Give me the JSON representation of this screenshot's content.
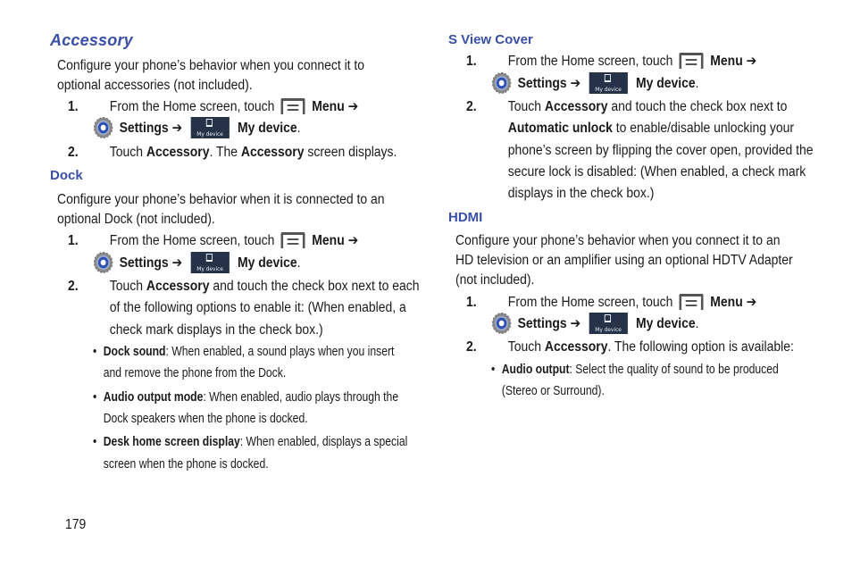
{
  "icons": {
    "menu": "menu-icon",
    "settings": "gear-icon",
    "my_device": "my-device-icon",
    "my_device_caption": "My device",
    "arrow": "➔"
  },
  "common_step1": {
    "num": "1.",
    "pre": "From the Home screen, touch",
    "menu": "Menu",
    "settings": "Settings",
    "my_device": "My device",
    "period": "."
  },
  "accessory": {
    "title": "Accessory",
    "intro_lines": [
      "Configure your phone’s behavior when you connect it to",
      "optional accessories (not included)."
    ],
    "step2": {
      "num": "2.",
      "t1": "Touch ",
      "b1": "Accessory",
      "t2": ". The ",
      "b2": "Accessory",
      "t3": " screen displays."
    }
  },
  "dock": {
    "title": "Dock",
    "intro_lines": [
      "Configure your phone’s behavior when it is connected to an",
      "optional Dock (not included)."
    ],
    "step2": {
      "num": "2.",
      "t1": "Touch ",
      "b1": "Accessory",
      "t2": " and touch the check box next to each",
      "line2": "of the following options to enable it: (When enabled, a",
      "line3": "check mark displays in the check box.)"
    },
    "bullets": [
      {
        "label": "Dock sound",
        "text": ": When enabled, a sound plays when you insert",
        "line2": "and remove the phone from the Dock."
      },
      {
        "label": "Audio output mode",
        "text": ": When enabled, audio plays through the",
        "line2": "Dock speakers when the phone is docked."
      },
      {
        "label": "Desk home screen display",
        "text": ": When enabled, displays a special",
        "line2": "screen when the phone is docked."
      }
    ]
  },
  "sview": {
    "title": "S View Cover",
    "step2": {
      "num": "2.",
      "t1": "Touch ",
      "b1": "Accessory",
      "t2": " and touch the check box next to",
      "b2": "Automatic unlock",
      "t3": " to enable/disable unlocking your",
      "line3": "phone’s screen by flipping the cover open, provided the",
      "line4": "secure lock is disabled: (When enabled, a check mark",
      "line5": "displays in the check box.)"
    }
  },
  "hdmi": {
    "title": "HDMI",
    "intro_lines": [
      "Configure your phone’s behavior when you connect it to an",
      "HD television or an amplifier using an optional HDTV Adapter",
      "(not included)."
    ],
    "step2": {
      "num": "2.",
      "t1": "Touch ",
      "b1": "Accessory",
      "t2": ". The following option is available:"
    },
    "bullets": [
      {
        "label": "Audio output",
        "text": ": Select the quality of sound to be produced",
        "line2": "(Stereo or Surround)."
      }
    ]
  },
  "bullet_char": "•",
  "page_number": "179"
}
